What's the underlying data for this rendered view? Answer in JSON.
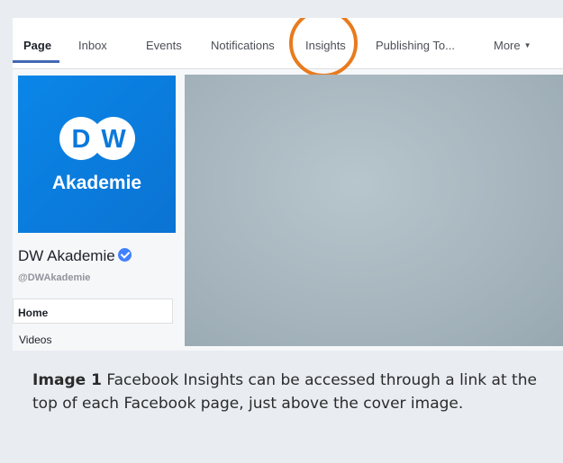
{
  "tabs": [
    {
      "label": "Page",
      "active": true
    },
    {
      "label": "Inbox"
    },
    {
      "label": "Events"
    },
    {
      "label": "Notifications"
    },
    {
      "label": "Insights",
      "highlighted": true
    },
    {
      "label": "Publishing To..."
    },
    {
      "label": "More"
    }
  ],
  "logo": {
    "mark": "DW",
    "word": "Akademie"
  },
  "page": {
    "name": "DW Akademie",
    "handle": "@DWAkademie"
  },
  "nav": {
    "home": "Home",
    "videos": "Videos"
  },
  "caption": {
    "label": "Image 1",
    "text": "Facebook Insights can be accessed through a link at the top of each Facebook page, just above the cover image."
  },
  "colors": {
    "highlight_ring": "#e87b1e",
    "accent": "#4267b2",
    "logo_bg": "#0a86e8",
    "verified": "#4080ff"
  }
}
